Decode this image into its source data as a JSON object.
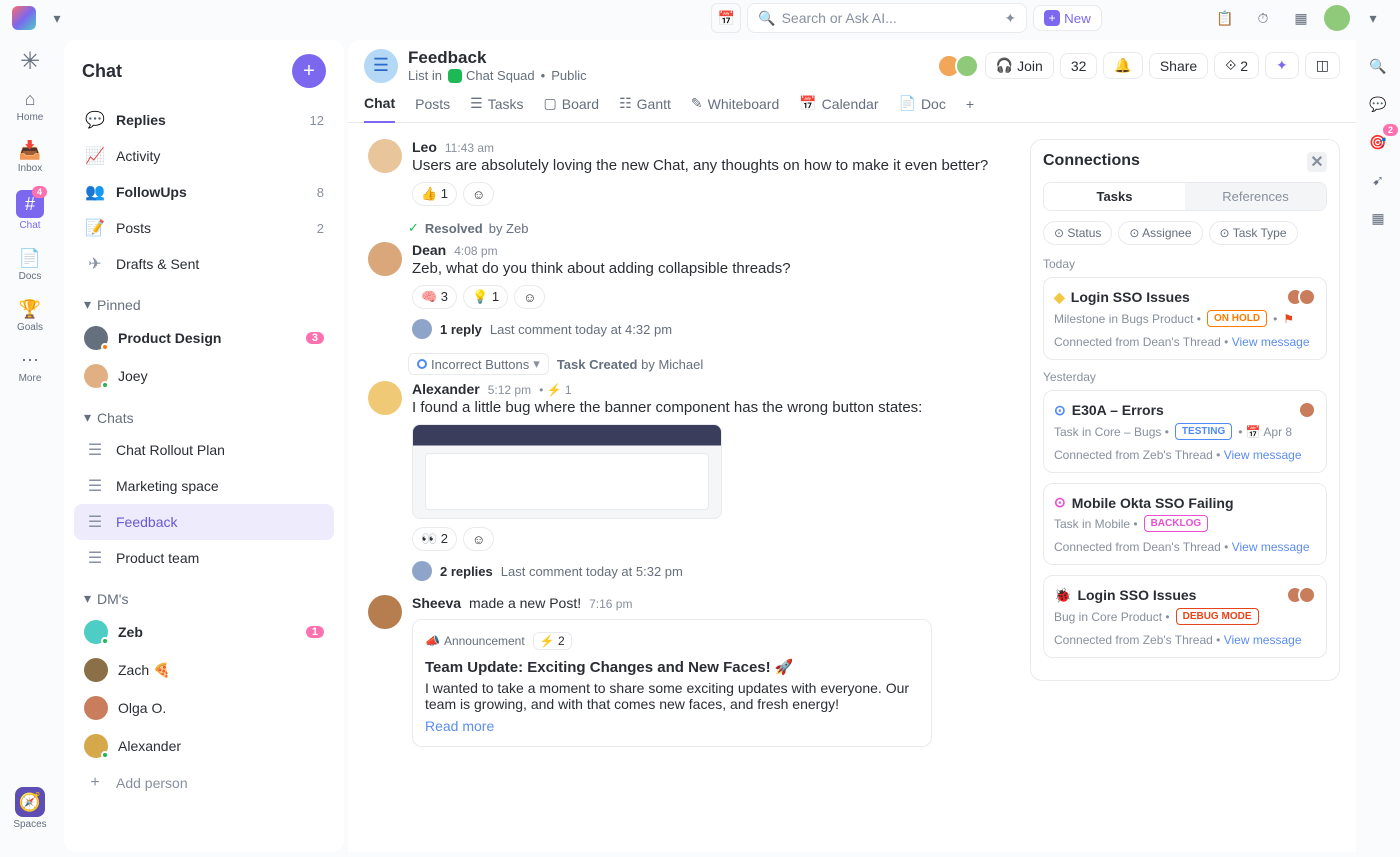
{
  "topbar": {
    "search_placeholder": "Search or Ask AI...",
    "new_label": "New"
  },
  "leftrail": {
    "items": [
      {
        "label": "Home"
      },
      {
        "label": "Inbox"
      },
      {
        "label": "Chat",
        "badge": "4",
        "active": true
      },
      {
        "label": "Docs"
      },
      {
        "label": "Goals"
      },
      {
        "label": "More"
      }
    ],
    "spaces_label": "Spaces"
  },
  "sidebar": {
    "title": "Chat",
    "nav": [
      {
        "label": "Replies",
        "count": "12",
        "bold": true
      },
      {
        "label": "Activity"
      },
      {
        "label": "FollowUps",
        "count": "8",
        "bold": true
      },
      {
        "label": "Posts",
        "count": "2"
      },
      {
        "label": "Drafts & Sent"
      }
    ],
    "sections": {
      "pinned": {
        "label": "Pinned",
        "items": [
          {
            "label": "Product Design",
            "count": "3",
            "bold": true,
            "avatar_bg": "#656f7d",
            "presence": "#ff7a00"
          },
          {
            "label": "Joey",
            "avatar_bg": "#e0b084",
            "presence": "#1db954"
          }
        ]
      },
      "chats": {
        "label": "Chats",
        "items": [
          {
            "label": "Chat Rollout Plan"
          },
          {
            "label": "Marketing space"
          },
          {
            "label": "Feedback",
            "active": true
          },
          {
            "label": "Product team"
          }
        ]
      },
      "dms": {
        "label": "DM's",
        "items": [
          {
            "label": "Zeb",
            "count": "1",
            "bold": true,
            "avatar_bg": "#4ecdc4",
            "presence": "#1db954"
          },
          {
            "label": "Zach 🍕",
            "avatar_bg": "#8b6f47"
          },
          {
            "label": "Olga O.",
            "avatar_bg": "#c97d5d"
          },
          {
            "label": "Alexander",
            "avatar_bg": "#d4a84b",
            "presence": "#1db954"
          }
        ]
      }
    },
    "add_person": "Add person"
  },
  "header": {
    "title": "Feedback",
    "crumb_prefix": "List in",
    "crumb_space": "Chat Squad",
    "crumb_visibility": "Public",
    "tabs": [
      "Chat",
      "Posts",
      "Tasks",
      "Board",
      "Gantt",
      "Whiteboard",
      "Calendar",
      "Doc"
    ],
    "active_tab": "Chat",
    "join_label": "Join",
    "member_count": "32",
    "share_label": "Share",
    "connection_count": "2"
  },
  "messages": [
    {
      "author": "Leo",
      "time": "11:43 am",
      "text": "Users are absolutely loving the new Chat, any thoughts on how to make it even better?",
      "avatar_bg": "#e8c59a",
      "reactions": [
        {
          "emoji": "👍",
          "count": "1"
        }
      ]
    },
    {
      "resolved_by": "Zeb"
    },
    {
      "author": "Dean",
      "time": "4:08 pm",
      "text": "Zeb, what do you think about adding collapsible threads?",
      "avatar_bg": "#d9a77a",
      "reactions": [
        {
          "emoji": "🧠",
          "count": "3"
        },
        {
          "emoji": "💡",
          "count": "1"
        }
      ],
      "thread": {
        "replies": "1 reply",
        "meta": "Last comment today at 4:32 pm"
      }
    },
    {
      "task_created": {
        "chip": "Incorrect Buttons",
        "label": "Task Created",
        "by": "Michael"
      }
    },
    {
      "author": "Alexander",
      "time": "5:12 pm",
      "sub": "1",
      "text": "I found a little bug where the banner component has the wrong button states:",
      "avatar_bg": "#f0c976",
      "has_attachment": true,
      "reactions": [
        {
          "emoji": "👀",
          "count": "2"
        }
      ],
      "thread": {
        "replies": "2 replies",
        "meta": "Last comment today at 5:32 pm"
      }
    },
    {
      "author": "Sheeva",
      "verb": "made a new Post!",
      "time": "7:16 pm",
      "avatar_bg": "#b67d4f",
      "post": {
        "tag": "Announcement",
        "sub": "2",
        "title": "Team Update: Exciting Changes and New Faces! 🚀",
        "body": "I wanted to take a moment to share some exciting updates with everyone. Our team is growing, and with that comes new faces, and fresh energy!",
        "read_more": "Read more"
      }
    }
  ],
  "connections": {
    "title": "Connections",
    "tabs": {
      "tasks": "Tasks",
      "references": "References"
    },
    "filters": [
      "Status",
      "Assignee",
      "Task Type"
    ],
    "groups": [
      {
        "label": "Today",
        "cards": [
          {
            "icon": "◆",
            "icon_color": "#f2c744",
            "title": "Login SSO Issues",
            "meta": "Milestone in Bugs Product",
            "status": "ON HOLD",
            "status_color": "#ff7a00",
            "flag": true,
            "avatars": 2,
            "foot": "Connected from Dean's Thread",
            "link": "View message"
          }
        ]
      },
      {
        "label": "Yesterday",
        "cards": [
          {
            "icon": "⊙",
            "icon_color": "#4f8af9",
            "title": "E30A – Errors",
            "meta": "Task in Core – Bugs",
            "status": "TESTING",
            "status_color": "#4f8af9",
            "date": "Apr 8",
            "avatars": 1,
            "foot": "Connected from Zeb's Thread",
            "link": "View message"
          },
          {
            "icon": "⊙",
            "icon_color": "#e84fd1",
            "title": "Mobile Okta SSO Failing",
            "meta": "Task in Mobile",
            "status": "BACKLOG",
            "status_color": "#e84fd1",
            "foot": "Connected from Dean's Thread",
            "link": "View message"
          },
          {
            "icon": "🐞",
            "icon_color": "#e8441a",
            "title": "Login SSO Issues",
            "meta": "Bug in Core Product",
            "status": "DEBUG MODE",
            "status_color": "#e8441a",
            "avatars": 2,
            "foot": "Connected from Zeb's Thread",
            "link": "View message"
          }
        ]
      }
    ]
  },
  "rightrail_badge": "2"
}
